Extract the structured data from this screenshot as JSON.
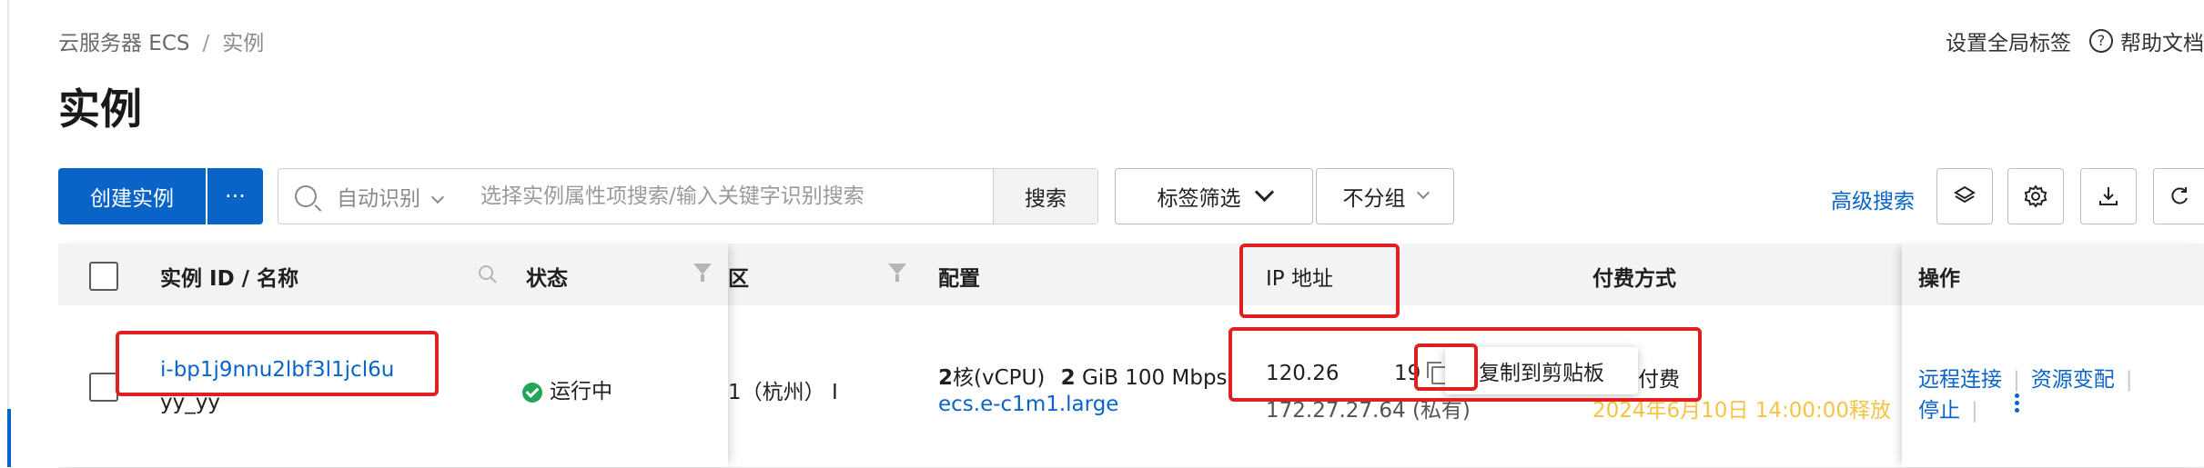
{
  "breadcrumb": {
    "root": "云服务器 ECS",
    "separator": "/",
    "current": "实例"
  },
  "page_title": "实例",
  "top_right": {
    "global_tags": "设置全局标签",
    "help_doc": "帮助文档",
    "help_icon": "?"
  },
  "toolbar": {
    "create_instance": "创建实例",
    "more": "···",
    "search_mode": "自动识别",
    "search_placeholder": "选择实例属性项搜索/输入关键字识别搜索",
    "search_button": "搜索",
    "tag_filter": "标签筛选",
    "group": "不分组",
    "advanced_search": "高级搜索"
  },
  "table": {
    "columns": {
      "instance": "实例 ID / 名称",
      "status": "状态",
      "zone": "区",
      "config": "配置",
      "ip": "IP 地址",
      "billing": "付费方式",
      "actions": "操作"
    },
    "row": {
      "instance_id": "i-bp1j9nnu2lbf3l1jcl6u",
      "instance_name": "yy_yy",
      "status": "运行中",
      "zone": "1（杭州） I",
      "config_cpu_num": "2",
      "config_cpu_unit": "核(vCPU)",
      "config_mem_num": "2",
      "config_mem_unit": "GiB 100 Mbps",
      "instance_type": "ecs.e-c1m1.large",
      "ip_public_a": "120.26",
      "ip_public_b": "19",
      "ip_public_paren": "(",
      "ip_private": "172.27.27.64 (私有)",
      "billing_tail": "付费",
      "release_time": "2024年6月10日 14:00:00释放",
      "action_remote": "远程连接",
      "action_resize": "资源变配",
      "action_stop": "停止",
      "action_sep": "|"
    }
  },
  "tooltip": "复制到剪贴板",
  "icons": [
    "search-icon",
    "chevron-down-icon",
    "layers-icon",
    "gear-icon",
    "download-icon",
    "refresh-icon",
    "filter-icon",
    "copy-icon",
    "check-circle-icon",
    "more-vertical-icon",
    "help-icon"
  ],
  "colors": {
    "primary": "#0a64c8",
    "success": "#23a55a",
    "warning": "#f6c344",
    "annotation": "#e02020"
  }
}
